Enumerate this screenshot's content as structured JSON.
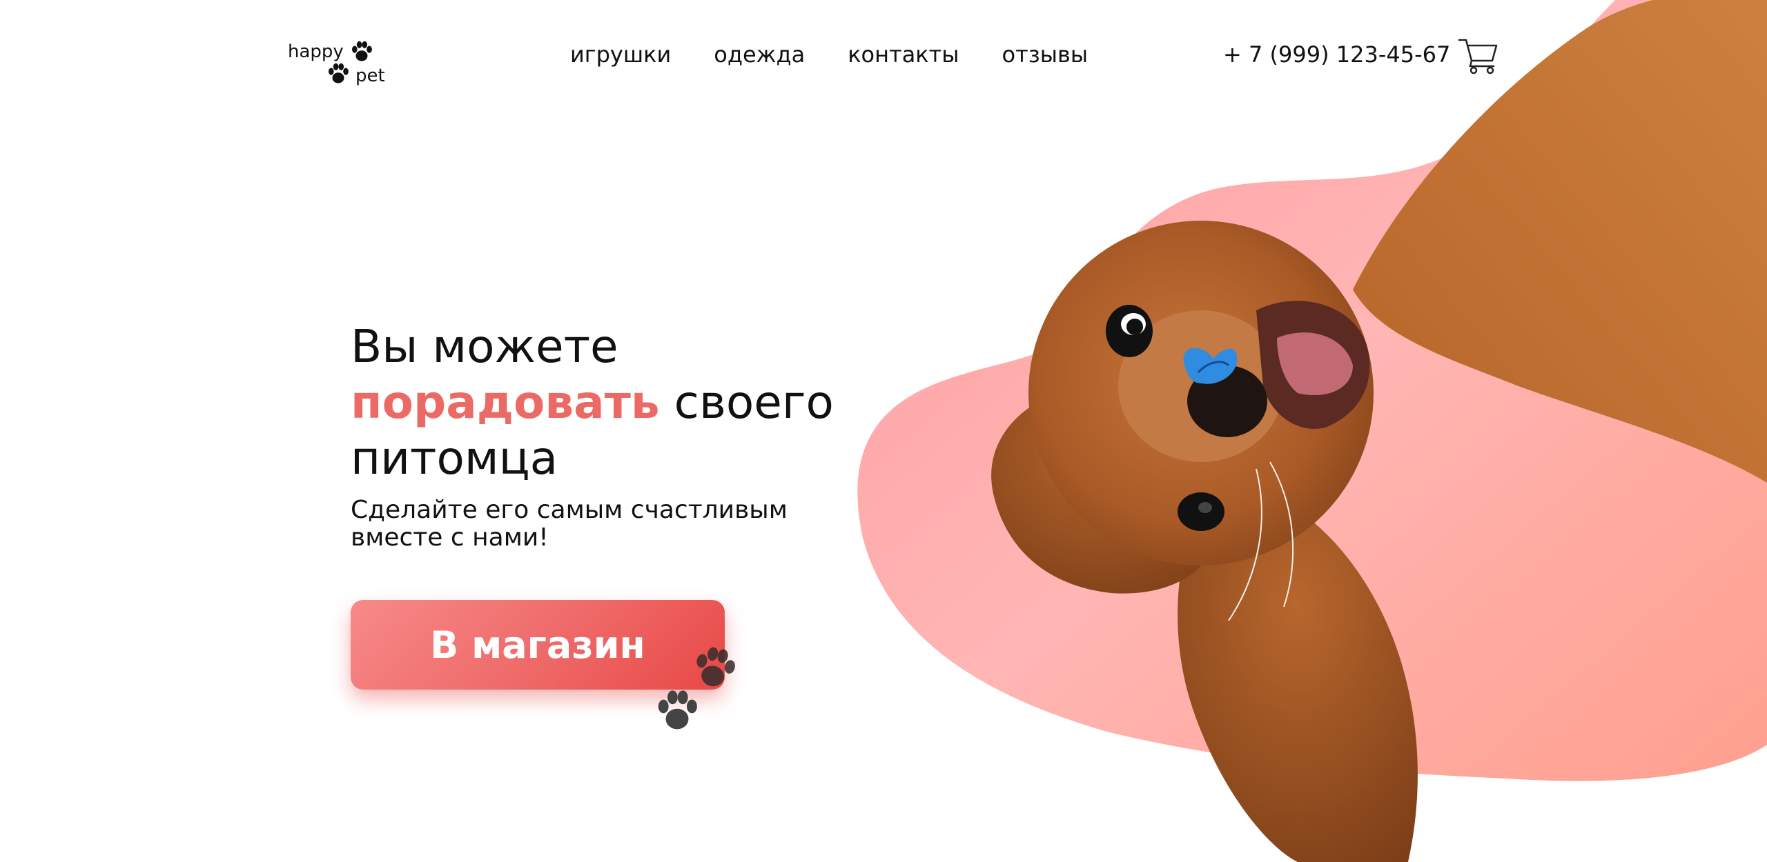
{
  "header": {
    "logo": {
      "word1": "happy",
      "word2": "pet",
      "icon": "paw-icon"
    },
    "nav": [
      {
        "label": "игрушки"
      },
      {
        "label": "одежда"
      },
      {
        "label": "контакты"
      },
      {
        "label": "отзывы"
      }
    ],
    "phone": "+ 7 (999) 123-45-67",
    "cart_icon": "cart-icon"
  },
  "hero": {
    "headline": {
      "line1": "Вы можете",
      "accent": "порадовать",
      "after_accent": " своего",
      "line3": "питомца"
    },
    "subtitle_line1": "Сделайте его самым счастливым",
    "subtitle_line2": "вместе с нами!",
    "cta_label": "В магазин",
    "image": "puppy-with-butterfly-on-nose"
  },
  "colors": {
    "accent": "#ec6a66",
    "button_start": "#f78a89",
    "button_end": "#e84845",
    "blob": "#ffb3b0",
    "text": "#111111"
  }
}
